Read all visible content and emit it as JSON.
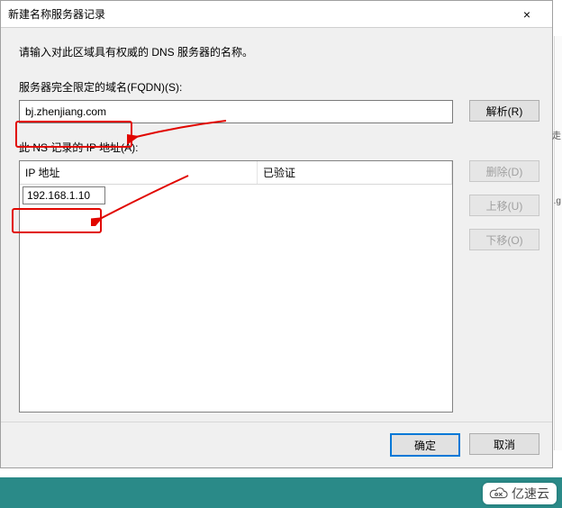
{
  "dialog": {
    "title": "新建名称服务器记录",
    "close_icon": "×",
    "instruction": "请输入对此区域具有权威的 DNS 服务器的名称。",
    "fqdn_label": "服务器完全限定的域名(FQDN)(S):",
    "fqdn_value": "bj.zhenjiang.com",
    "resolve_label": "解析(R)",
    "ip_label": "此 NS 记录的 IP 地址(A):",
    "columns": {
      "ip": "IP 地址",
      "verified": "已验证"
    },
    "rows": [
      {
        "ip": "192.168.1.10",
        "verified": ""
      }
    ],
    "side_buttons": {
      "delete": "删除(D)",
      "move_up": "上移(U)",
      "move_down": "下移(O)"
    },
    "ok": "确定",
    "cancel": "取消"
  },
  "edge": {
    "a": "走",
    "b": ".g"
  },
  "watermark": "亿速云"
}
